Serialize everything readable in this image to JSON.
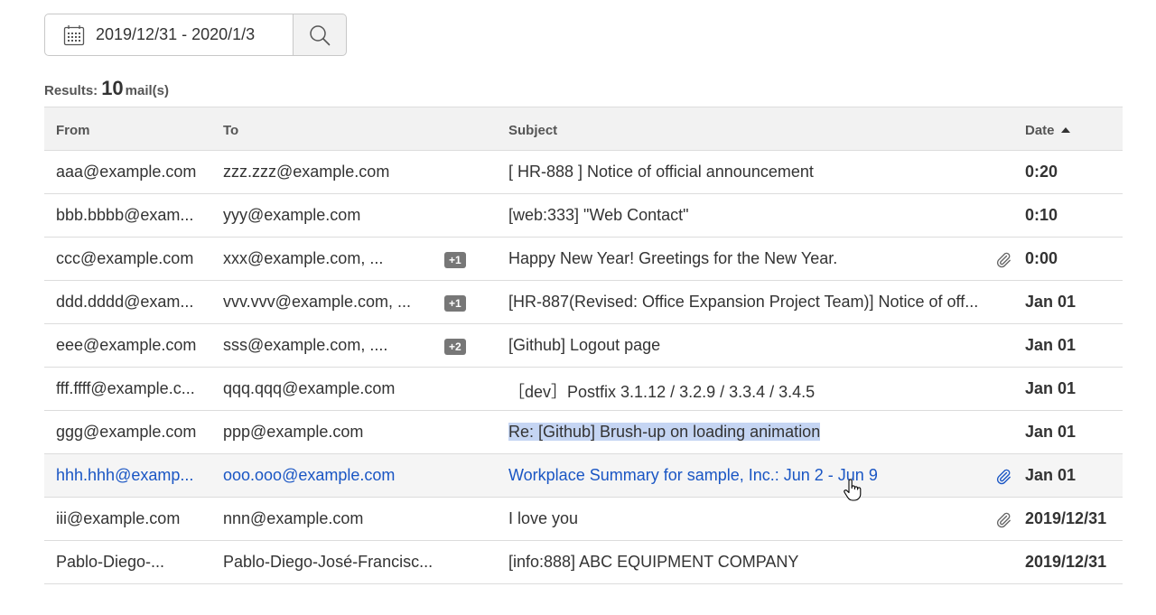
{
  "search": {
    "date_range": "2019/12/31 - 2020/1/3",
    "calendar_icon": "calendar-icon",
    "search_icon": "search-icon"
  },
  "results": {
    "label": "Results:",
    "count": "10",
    "unit": "mail(s)"
  },
  "table": {
    "headers": {
      "from": "From",
      "to": "To",
      "subject": "Subject",
      "date": "Date"
    },
    "sort": {
      "column": "Date",
      "direction": "ascending"
    },
    "rows": [
      {
        "from": "aaa@example.com",
        "to": "zzz.zzz@example.com",
        "badge": "",
        "subject": "[ HR-888 ] Notice of official announcement",
        "attachment": false,
        "date": "0:20"
      },
      {
        "from": "bbb.bbbb@exam...",
        "to": "yyy@example.com",
        "badge": "",
        "subject": "[web:333] \"Web Contact\"",
        "attachment": false,
        "date": "0:10"
      },
      {
        "from": "ccc@example.com",
        "to": "xxx@example.com, ...",
        "badge": "+1",
        "subject": "Happy New Year! Greetings for the New Year.",
        "attachment": true,
        "date": "0:00"
      },
      {
        "from": "ddd.dddd@exam...",
        "to": "vvv.vvv@example.com, ...",
        "badge": "+1",
        "subject": "[HR-887(Revised: Office Expansion Project Team)] Notice of off...",
        "attachment": false,
        "date": "Jan 01"
      },
      {
        "from": "eee@example.com",
        "to": "sss@example.com, ....",
        "badge": "+2",
        "subject": "[Github] Logout page",
        "attachment": false,
        "date": "Jan 01"
      },
      {
        "from": "fff.ffff@example.c...",
        "to": "qqq.qqq@example.com",
        "badge": "",
        "subject": "［dev］Postfix 3.1.12 / 3.2.9 / 3.3.4 / 3.4.5",
        "attachment": false,
        "date": "Jan 01"
      },
      {
        "from": "ggg@example.com",
        "to": "ppp@example.com",
        "badge": "",
        "subject": "Re: [Github] Brush-up on loading animation",
        "attachment": false,
        "date": "Jan 01",
        "selected_text": true
      },
      {
        "from": "hhh.hhh@examp...",
        "to": "ooo.ooo@example.com",
        "badge": "",
        "subject": "Workplace Summary for sample, Inc.: Jun 2 - Jun 9",
        "attachment": true,
        "date": "Jan 01",
        "hovered": true
      },
      {
        "from": "iii@example.com",
        "to": "nnn@example.com",
        "badge": "",
        "subject": "I love you",
        "attachment": true,
        "date": "2019/12/31"
      },
      {
        "from": "Pablo-Diego-...",
        "to": "Pablo-Diego-José-Francisc...",
        "badge": "",
        "subject": "[info:888] ABC EQUIPMENT COMPANY",
        "attachment": false,
        "date": "2019/12/31"
      }
    ]
  },
  "colors": {
    "header_bg": "#f2f2f2",
    "hover_text": "#1a56c4",
    "selection_bg": "#c5d5f3",
    "badge_bg": "#777777"
  }
}
